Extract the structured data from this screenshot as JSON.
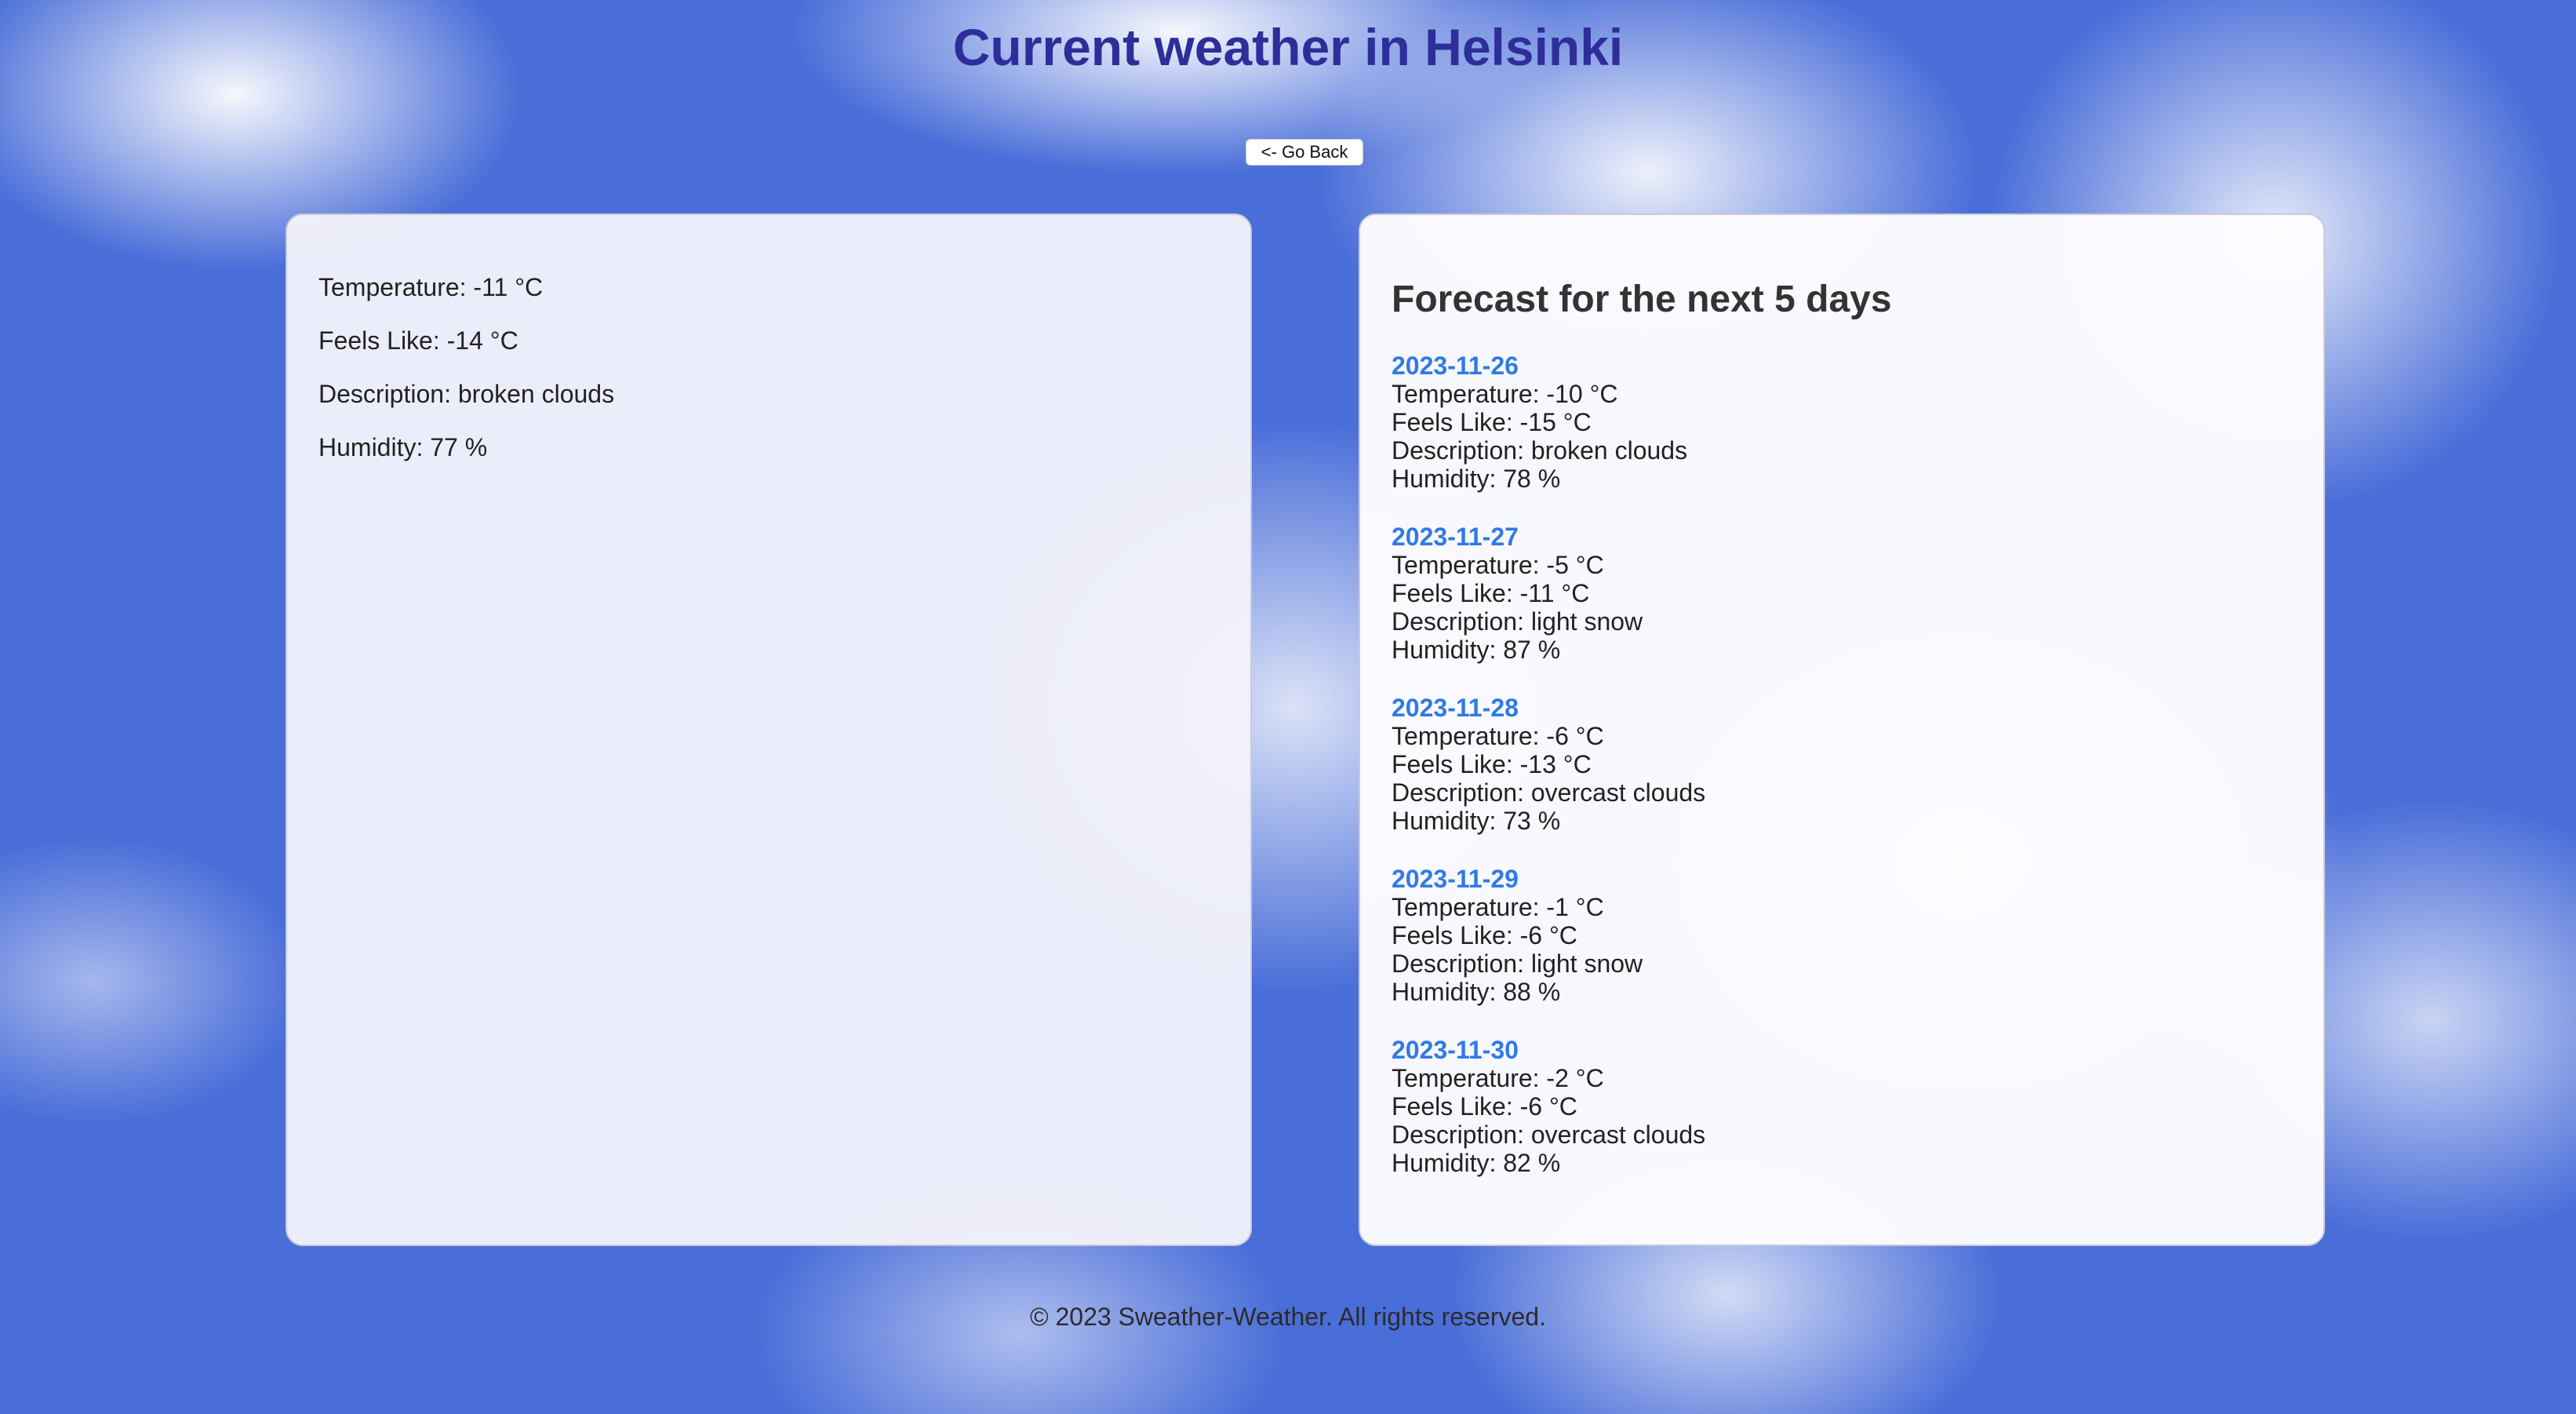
{
  "header": {
    "title": "Current weather in Helsinki",
    "back_label": "<- Go Back"
  },
  "current": {
    "temperature": "Temperature: -11 °C",
    "feels_like": "Feels Like: -14 °C",
    "description": "Description: broken clouds",
    "humidity": "Humidity: 77 %"
  },
  "forecast": {
    "title": "Forecast for the next 5 days",
    "days": [
      {
        "date": "2023-11-26",
        "temperature": "Temperature: -10 °C",
        "feels_like": "Feels Like: -15 °C",
        "description": "Description: broken clouds",
        "humidity": "Humidity: 78 %"
      },
      {
        "date": "2023-11-27",
        "temperature": "Temperature: -5 °C",
        "feels_like": "Feels Like: -11 °C",
        "description": "Description: light snow",
        "humidity": "Humidity: 87 %"
      },
      {
        "date": "2023-11-28",
        "temperature": "Temperature: -6 °C",
        "feels_like": "Feels Like: -13 °C",
        "description": "Description: overcast clouds",
        "humidity": "Humidity: 73 %"
      },
      {
        "date": "2023-11-29",
        "temperature": "Temperature: -1 °C",
        "feels_like": "Feels Like: -6 °C",
        "description": "Description: light snow",
        "humidity": "Humidity: 88 %"
      },
      {
        "date": "2023-11-30",
        "temperature": "Temperature: -2 °C",
        "feels_like": "Feels Like: -6 °C",
        "description": "Description: overcast clouds",
        "humidity": "Humidity: 82 %"
      }
    ]
  },
  "footer": {
    "text": "© 2023 Sweather-Weather. All rights reserved."
  },
  "colors": {
    "title": "#2e2e9a",
    "date_link": "#2f7ae5",
    "sky": "#4a6ed9"
  }
}
